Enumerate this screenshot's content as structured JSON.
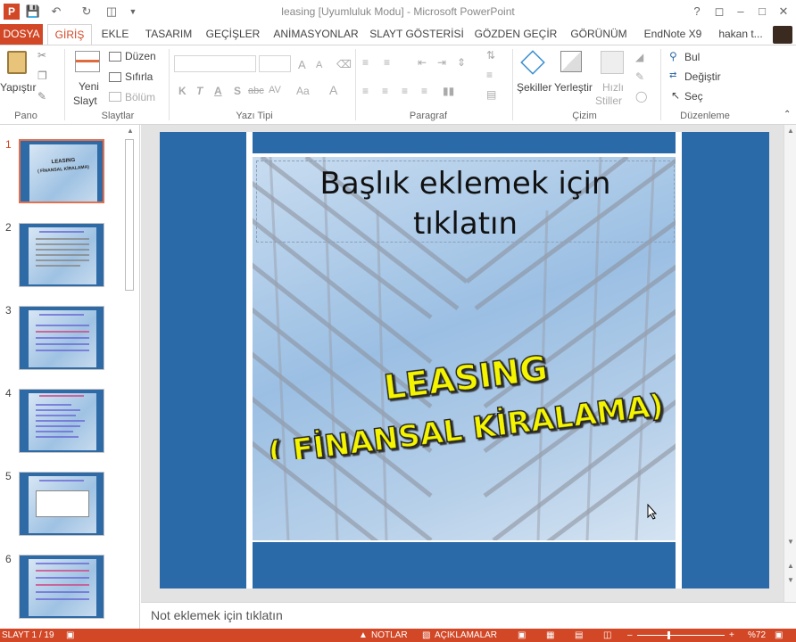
{
  "window": {
    "title": "leasing [Uyumluluk Modu] - Microsoft PowerPoint"
  },
  "tabs": [
    "DOSYA",
    "GİRİŞ",
    "EKLE",
    "TASARIM",
    "GEÇİŞLER",
    "ANİMASYONLAR",
    "SLAYT GÖSTERİSİ",
    "GÖZDEN GEÇİR",
    "GÖRÜNÜM",
    "EndNote X9"
  ],
  "user": {
    "name": "hakan t..."
  },
  "ribbon": {
    "pano": {
      "paste_label": "Yapıştır",
      "group_label": "Pano"
    },
    "slaytlar": {
      "new_slide_line1": "Yeni",
      "new_slide_line2": "Slayt",
      "layout": "Düzen",
      "reset": "Sıfırla",
      "section": "Bölüm",
      "group_label": "Slaytlar"
    },
    "yazi_tipi": {
      "bold": "K",
      "italic": "T",
      "underline": "A",
      "shadow": "S",
      "strike": "abc",
      "spacing": "AV",
      "case": "Aa",
      "color": "A",
      "grow": "A",
      "shrink": "A",
      "group_label": "Yazı Tipi"
    },
    "paragraf": {
      "group_label": "Paragraf"
    },
    "cizim": {
      "shapes": "Şekiller",
      "arrange": "Yerleştir",
      "quick_styles_1": "Hızlı",
      "quick_styles_2": "Stiller",
      "group_label": "Çizim"
    },
    "duzenleme": {
      "find": "Bul",
      "replace": "Değiştir",
      "select": "Seç",
      "group_label": "Düzenleme"
    }
  },
  "thumbnails": [
    "1",
    "2",
    "3",
    "4",
    "5",
    "6"
  ],
  "slide": {
    "title_placeholder_line1": "Başlık eklemek için",
    "title_placeholder_line2": "tıklatın",
    "wordart_line1": "LEASING",
    "wordart_line2": "( FİNANSAL KİRALAMA)",
    "thumb1_line1": "LEASING",
    "thumb1_line2": "( FİNANSAL KİRALAMA)"
  },
  "notes": {
    "placeholder": "Not eklemek için tıklatın"
  },
  "status": {
    "slide": "SLAYT 1 / 19",
    "notes": "NOTLAR",
    "comments": "AÇIKLAMALAR",
    "zoom": "%72"
  },
  "colors": {
    "accent": "#d24726",
    "slide_bg": "#2b6aa8",
    "wordart_fill": "#f5f500"
  }
}
